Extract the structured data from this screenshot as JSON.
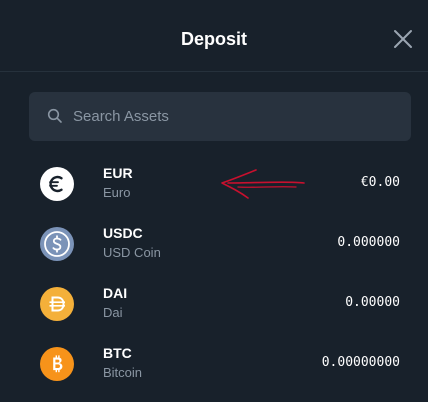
{
  "header": {
    "title": "Deposit",
    "close_icon": "close-icon"
  },
  "search": {
    "placeholder": "Search Assets",
    "value": "",
    "icon": "search-icon"
  },
  "assets": [
    {
      "symbol": "EUR",
      "name": "Euro",
      "balance": "€0.00",
      "icon": "euro-coin-icon",
      "color": "#ffffff"
    },
    {
      "symbol": "USDC",
      "name": "USD Coin",
      "balance": "0.000000",
      "icon": "usdc-coin-icon",
      "color": "#7b93b8"
    },
    {
      "symbol": "DAI",
      "name": "Dai",
      "balance": "0.00000",
      "icon": "dai-coin-icon",
      "color": "#f4b03a"
    },
    {
      "symbol": "BTC",
      "name": "Bitcoin",
      "balance": "0.00000000",
      "icon": "bitcoin-coin-icon",
      "color": "#f7931a"
    }
  ],
  "annotation": {
    "icon": "red-arrow-annotation-icon",
    "color": "#c8102e"
  },
  "colors": {
    "background": "#18212b",
    "search_bg": "#28323e",
    "muted_text": "#8a96a3"
  }
}
